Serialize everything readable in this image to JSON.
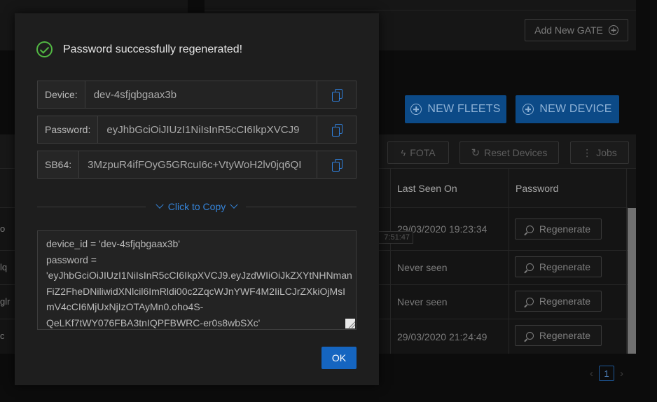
{
  "background": {
    "add_gate_label": "Add New GATE",
    "new_fleets_label": "NEW FLEETS",
    "new_device_label": "NEW DEVICE",
    "toolbar": {
      "fota_label": "FOTA",
      "reset_devices_label": "Reset Devices",
      "jobs_label": "Jobs"
    },
    "columns": {
      "last_seen": "Last Seen On",
      "password": "Password"
    },
    "rows": [
      {
        "id_fragment": "o",
        "last_seen": "29/03/2020 19:23:34",
        "action": "Regenerate"
      },
      {
        "id_fragment": "lq",
        "last_seen": "Never seen",
        "action": "Regenerate"
      },
      {
        "id_fragment": "glr",
        "last_seen": "Never seen",
        "action": "Regenerate"
      },
      {
        "id_fragment": "c",
        "last_seen": "29/03/2020 21:24:49",
        "action": "Regenerate"
      }
    ],
    "tooltip_fragment": "7:51:47",
    "pagination": {
      "prev": "‹",
      "current_page": "1",
      "next": "›"
    }
  },
  "modal": {
    "title": "Password successfully regenerated!",
    "fields": {
      "device_label": "Device:",
      "device_value": "dev-4sfjqbgaax3b",
      "password_label": "Password:",
      "password_value": "eyJhbGciOiJIUzI1NiIsInR5cCI6IkpXVCJ9",
      "sb64_label": "SB64:",
      "sb64_value": "3MzpuR4ifFOyG5GRcuI6c+VtyWoH2lv0jq6QI"
    },
    "click_to_copy": "Click to Copy",
    "code_lines": [
      "device_id = 'dev-4sfjqbgaax3b'",
      "password =",
      "'eyJhbGciOiJIUzI1NiIsInR5cCI6IkpXVCJ9.eyJzdWIiOiJkZXYtNHNman",
      "FiZ2FheDNiliwidXNlcil6ImRldi00c2ZqcWJnYWF4M2IiLCJrZXkiOjMsI",
      "mV4cCI6MjUxNjIzOTAyMn0.oho4S-",
      "QeLKf7tWY076FBA3tnIQPFBWRC-er0s8wbSXc'"
    ],
    "ok_label": "OK"
  },
  "colors": {
    "accent": "#1565c0",
    "success": "#52b843",
    "link": "#3584d9"
  }
}
